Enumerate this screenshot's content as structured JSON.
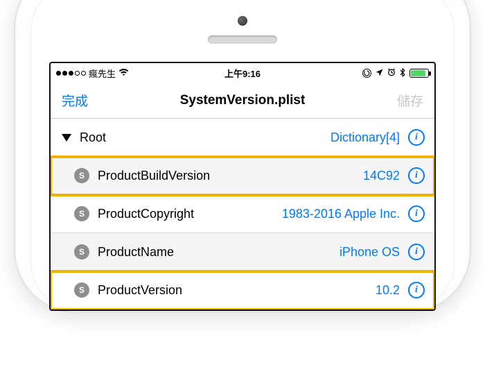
{
  "statusbar": {
    "carrier": "瘋先生",
    "time": "上午9:16",
    "signal_filled": 3,
    "signal_total": 5,
    "battery_percent": 80,
    "battery_color": "#4cd964"
  },
  "navbar": {
    "left": "完成",
    "title": "SystemVersion.plist",
    "right": "儲存"
  },
  "root": {
    "key": "Root",
    "value": "Dictionary[4]"
  },
  "entries": [
    {
      "type": "S",
      "key": "ProductBuildVersion",
      "value": "14C92",
      "alt": true,
      "highlight": true
    },
    {
      "type": "S",
      "key": "ProductCopyright",
      "value": "1983-2016 Apple Inc.",
      "alt": false,
      "highlight": false
    },
    {
      "type": "S",
      "key": "ProductName",
      "value": "iPhone OS",
      "alt": true,
      "highlight": false
    },
    {
      "type": "S",
      "key": "ProductVersion",
      "value": "10.2",
      "alt": false,
      "highlight": true
    }
  ]
}
